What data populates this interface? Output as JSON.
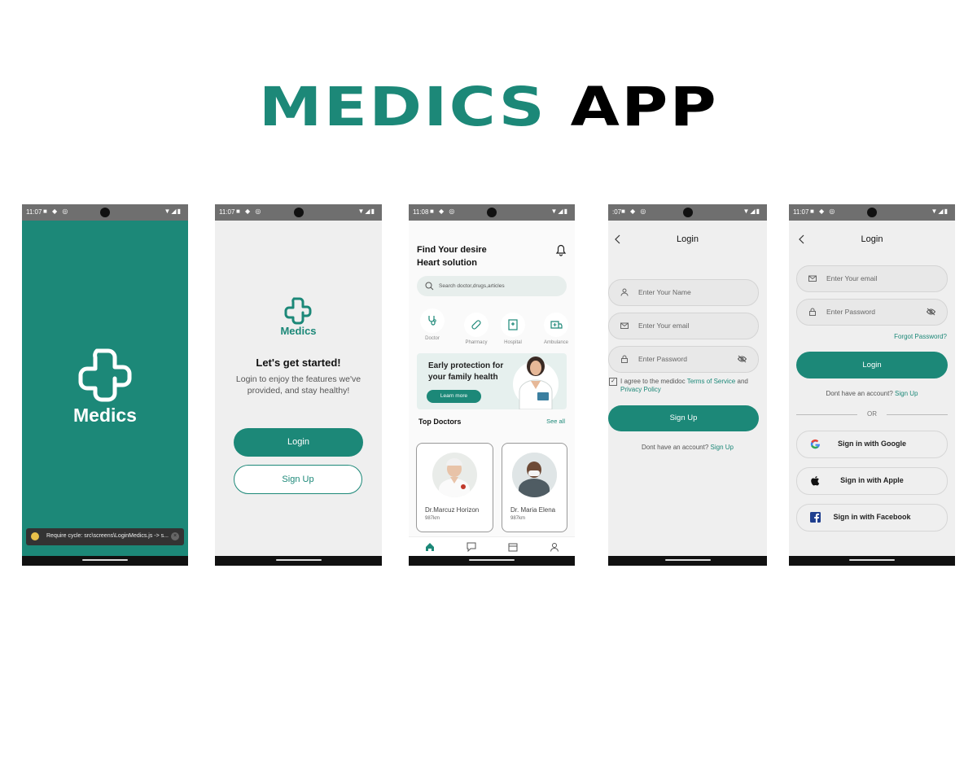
{
  "header": {
    "title_part1": "MEDICS",
    "title_part2": "APP"
  },
  "colors": {
    "accent": "#1c8878",
    "dark": "#000000"
  },
  "status": {
    "time1": "11:07",
    "time2": "11:07",
    "time3": "11:08",
    "time4": ":07",
    "time5": "11:07"
  },
  "splash": {
    "brand": "Medics",
    "toast": "Require cycle: src\\screens\\LoginMedics.js -> s..."
  },
  "welcome": {
    "brand": "Medics",
    "heading": "Let's get started!",
    "subtitle": "Login to enjoy the features we've provided, and stay healthy!",
    "login_label": "Login",
    "signup_label": "Sign Up"
  },
  "home": {
    "heading_line1": "Find Your desire",
    "heading_line2": "Heart solution",
    "search_placeholder": "Search doctor,drugs,articles",
    "categories": [
      "Doctor",
      "Pharmacy",
      "Hospital",
      "Ambulance"
    ],
    "banner_line1": "Early protection for",
    "banner_line2": "your family health",
    "banner_button": "Learn more",
    "section_title": "Top Doctors",
    "see_all": "See all",
    "doctors": [
      {
        "name": "Dr.Marcuz Horizon",
        "distance": "987km"
      },
      {
        "name": "Dr. Maria Elena",
        "distance": "987km"
      }
    ]
  },
  "signup": {
    "title": "Login",
    "name_placeholder": "Enter Your Name",
    "email_placeholder": "Enter Your email",
    "password_placeholder": "Enter Password",
    "agree_text": "I agree to the medidoc ",
    "terms": "Terms of Service",
    "and": " and",
    "privacy": "Privacy Policy",
    "button": "Sign Up",
    "footer_text": "Dont have an account?",
    "footer_link": "Sign Up"
  },
  "login": {
    "title": "Login",
    "email_placeholder": "Enter Your email",
    "password_placeholder": "Enter Password",
    "forgot": "Forgot Password?",
    "button": "Login",
    "footer_text": "Dont have an account?",
    "footer_link": "Sign Up",
    "or": "OR",
    "google": "Sign in with Google",
    "apple": "Sign in with Apple",
    "facebook": "Sign in with Facebook"
  }
}
